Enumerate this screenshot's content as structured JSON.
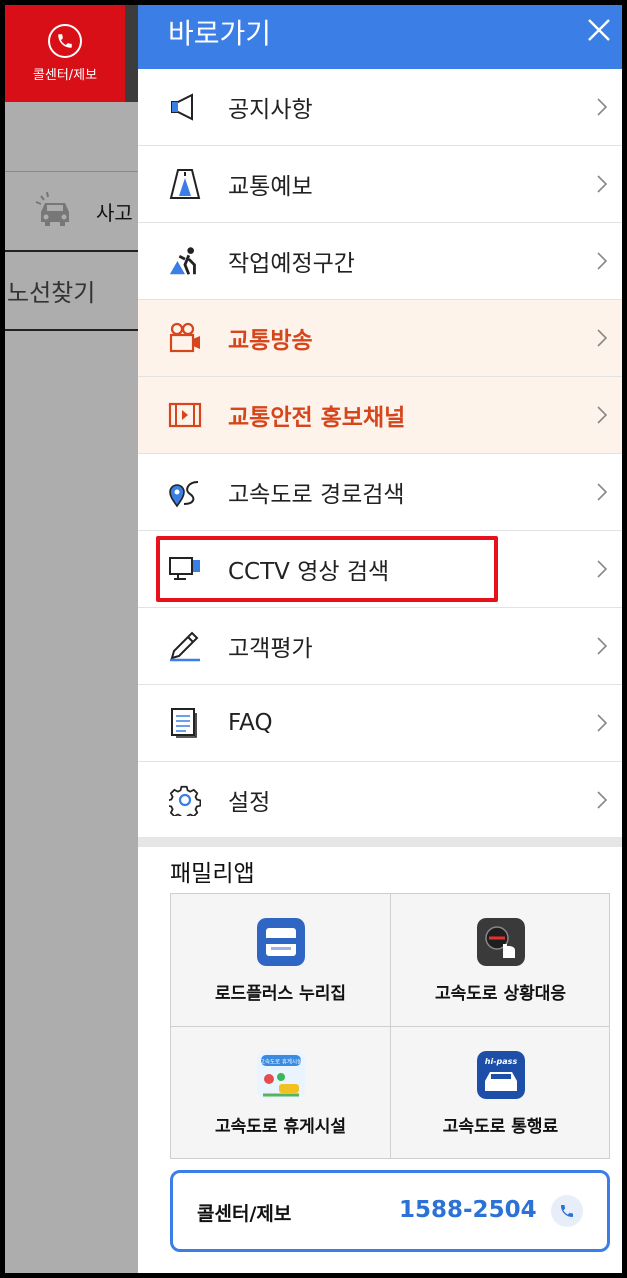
{
  "background": {
    "callcenter_label": "콜센터/제보",
    "row1_label": "사고",
    "row2_label": "노선찾기"
  },
  "drawer": {
    "title": "바로가기",
    "menu": [
      {
        "label": "공지사항",
        "icon": "megaphone-icon",
        "highlight": false
      },
      {
        "label": "교통예보",
        "icon": "road-forecast-icon",
        "highlight": false
      },
      {
        "label": "작업예정구간",
        "icon": "road-work-icon",
        "highlight": false
      },
      {
        "label": "교통방송",
        "icon": "video-camera-icon",
        "highlight": true
      },
      {
        "label": "교통안전 홍보채널",
        "icon": "video-play-icon",
        "highlight": true
      },
      {
        "label": "고속도로 경로검색",
        "icon": "route-pin-icon",
        "highlight": false
      },
      {
        "label": "CCTV 영상 검색",
        "icon": "cctv-monitor-icon",
        "highlight": false
      },
      {
        "label": "고객평가",
        "icon": "pencil-icon",
        "highlight": false
      },
      {
        "label": "FAQ",
        "icon": "document-list-icon",
        "highlight": false
      },
      {
        "label": "설정",
        "icon": "gear-icon",
        "highlight": false
      }
    ],
    "family_title": "패밀리앱",
    "family_apps": [
      {
        "label": "로드플러스 누리집",
        "icon": "roadplus-app-icon"
      },
      {
        "label": "고속도로 상황대응",
        "icon": "situation-app-icon"
      },
      {
        "label": "고속도로 휴게시설",
        "icon": "rest-area-app-icon",
        "icon_text": "고속도로 휴게시설"
      },
      {
        "label": "고속도로 통행료",
        "icon": "hipass-app-icon",
        "icon_text": "hi-pass"
      }
    ],
    "callcenter": {
      "label": "콜센터/제보",
      "number": "1588-2504"
    }
  },
  "colors": {
    "header_blue": "#3a7ee6",
    "highlight_orange": "#d6461c",
    "highlight_bg": "#fef3ea",
    "callcenter_red": "#d90f17",
    "annotation_red": "#e8101a"
  }
}
